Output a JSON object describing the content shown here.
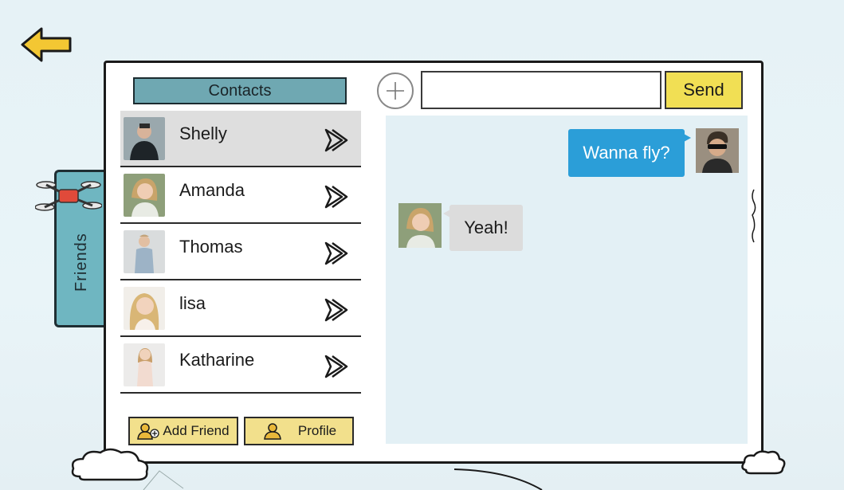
{
  "sidebar": {
    "friends_tab_label": "Friends"
  },
  "contacts": {
    "header": "Contacts",
    "items": [
      {
        "name": "Shelly",
        "selected": true,
        "avatar": "person-avatar"
      },
      {
        "name": "Amanda",
        "selected": false,
        "avatar": "person-avatar"
      },
      {
        "name": "Thomas",
        "selected": false,
        "avatar": "person-avatar"
      },
      {
        "name": "lisa",
        "selected": false,
        "avatar": "person-avatar"
      },
      {
        "name": "Katharine",
        "selected": false,
        "avatar": "person-avatar"
      }
    ],
    "add_friend_label": "Add Friend",
    "profile_label": "Profile"
  },
  "composer": {
    "input_value": "",
    "placeholder": "",
    "send_label": "Send"
  },
  "chat": {
    "messages": [
      {
        "from": "me",
        "text": "Wanna fly?"
      },
      {
        "from": "friend",
        "text": "Yeah!"
      }
    ]
  },
  "icons": [
    "back-arrow-icon",
    "drone-icon",
    "plus-icon",
    "chevron-right-icon",
    "add-friend-icon",
    "profile-icon"
  ],
  "colors": {
    "accent_teal": "#6fb6c1",
    "send_yellow": "#f1df54",
    "button_yellow": "#f2e08c",
    "bubble_blue": "#2b9ed8",
    "chat_bg": "#e3f0f5"
  }
}
